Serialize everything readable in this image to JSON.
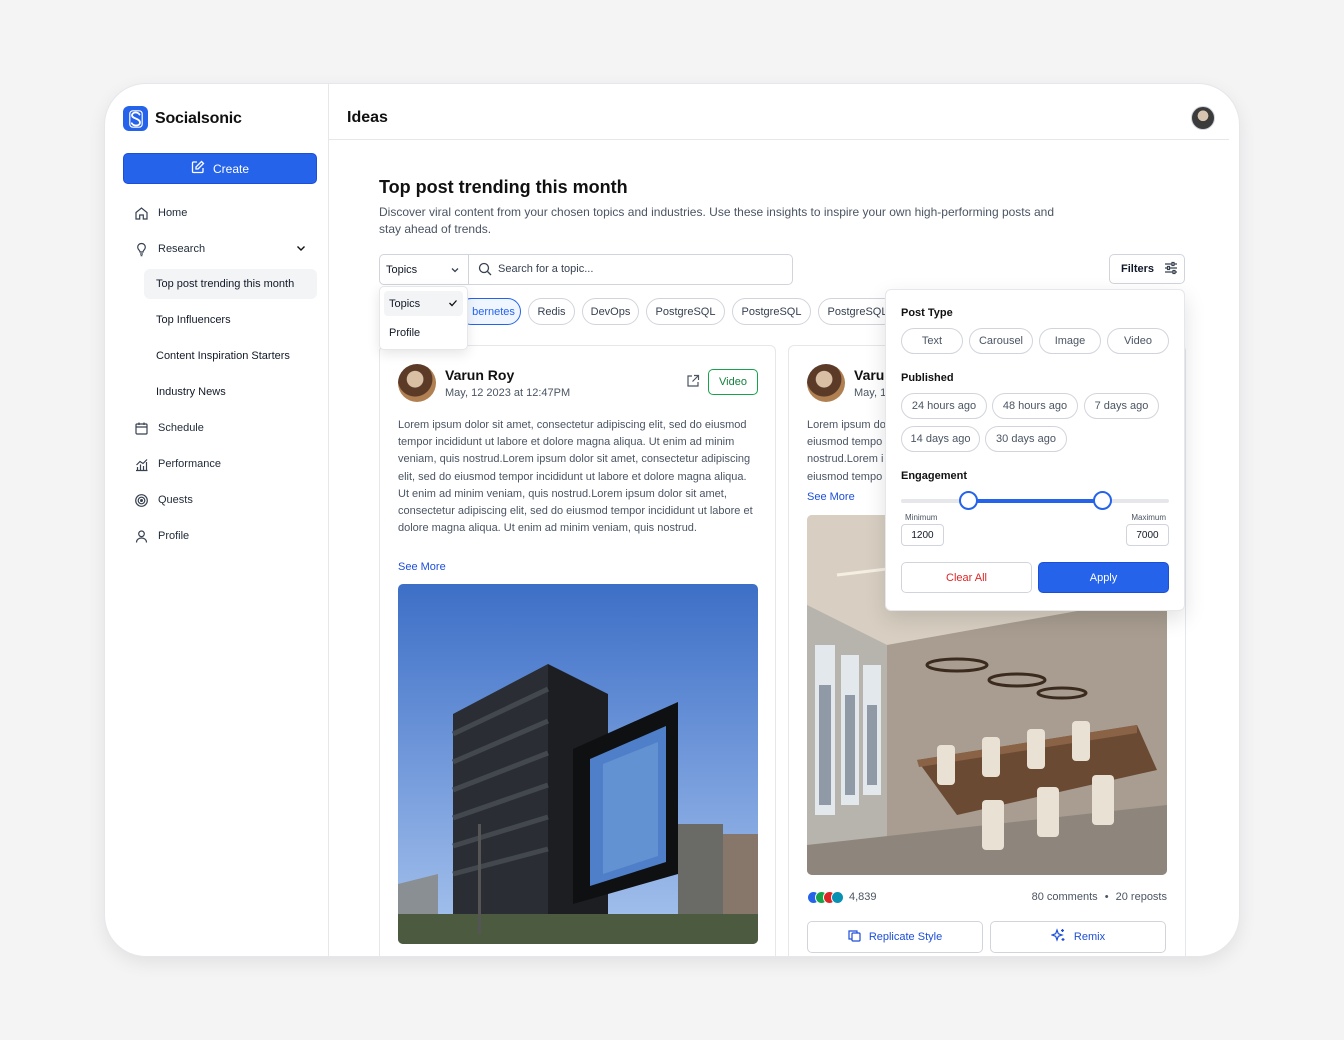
{
  "app": {
    "name": "Socialsonic",
    "brand_color": "#2563eb"
  },
  "sidebar": {
    "create_label": "Create",
    "items": [
      {
        "label": "Home",
        "icon": "home-icon"
      },
      {
        "label": "Research",
        "icon": "lightbulb-icon"
      },
      {
        "label": "Schedule",
        "icon": "calendar-icon"
      },
      {
        "label": "Performance",
        "icon": "chart-icon"
      },
      {
        "label": "Quests",
        "icon": "target-icon"
      },
      {
        "label": "Profile",
        "icon": "user-icon"
      }
    ],
    "research_sub": [
      {
        "label": "Top post trending this month",
        "active": true
      },
      {
        "label": "Top Influencers"
      },
      {
        "label": "Content Inspiration Starters"
      },
      {
        "label": "Industry News"
      }
    ]
  },
  "header": {
    "title": "Ideas"
  },
  "main": {
    "title": "Top post trending this month",
    "description": "Discover viral content from your chosen topics and industries. Use these insights to inspire your own high-performing posts and stay ahead of trends.",
    "search": {
      "select_value": "Topics",
      "placeholder": "Search for a topic..."
    },
    "filters_label": "Filters",
    "dropdown_options": [
      "Topics",
      "Profile"
    ],
    "tags": [
      "bernetes",
      "Redis",
      "DevOps",
      "PostgreSQL",
      "PostgreSQL",
      "PostgreSQL"
    ]
  },
  "cards": [
    {
      "author": "Varun Roy",
      "date": "May, 12 2023 at 12:47PM",
      "badge": "Video",
      "body": "Lorem ipsum dolor sit amet, consectetur adipiscing elit, sed do eiusmod tempor incididunt ut labore et dolore magna aliqua. Ut enim ad minim veniam, quis nostrud.Lorem ipsum dolor sit amet, consectetur adipiscing elit, sed do eiusmod tempor incididunt ut labore et dolore magna aliqua. Ut enim ad minim veniam, quis nostrud.Lorem ipsum dolor sit amet, consectetur adipiscing elit, sed do eiusmod tempor incididunt ut labore et dolore magna aliqua. Ut enim ad minim veniam, quis nostrud.",
      "see_more": "See More"
    },
    {
      "author": "Varu",
      "date": "May, 1",
      "body_lines": [
        "Lorem ipsum do",
        "eiusmod tempo",
        "nostrud.Lorem i",
        "eiusmod tempo"
      ],
      "see_more": "See More",
      "reactions": "4,839",
      "comments": "80 comments",
      "reposts": "20 reposts",
      "separator": "•",
      "replicate_label": "Replicate Style",
      "remix_label": "Remix"
    }
  ],
  "filter_panel": {
    "post_type_label": "Post Type",
    "post_types": [
      "Text",
      "Carousel",
      "Image",
      "Video"
    ],
    "published_label": "Published",
    "published": [
      "24 hours ago",
      "48 hours ago",
      "7 days ago",
      "14 days ago",
      "30 days ago"
    ],
    "engagement_label": "Engagement",
    "min_label": "Minimum",
    "max_label": "Maximum",
    "min_value": "1200",
    "max_value": "7000",
    "slider_min_fraction": 0.25,
    "slider_max_fraction": 0.75,
    "clear_label": "Clear All",
    "apply_label": "Apply"
  }
}
